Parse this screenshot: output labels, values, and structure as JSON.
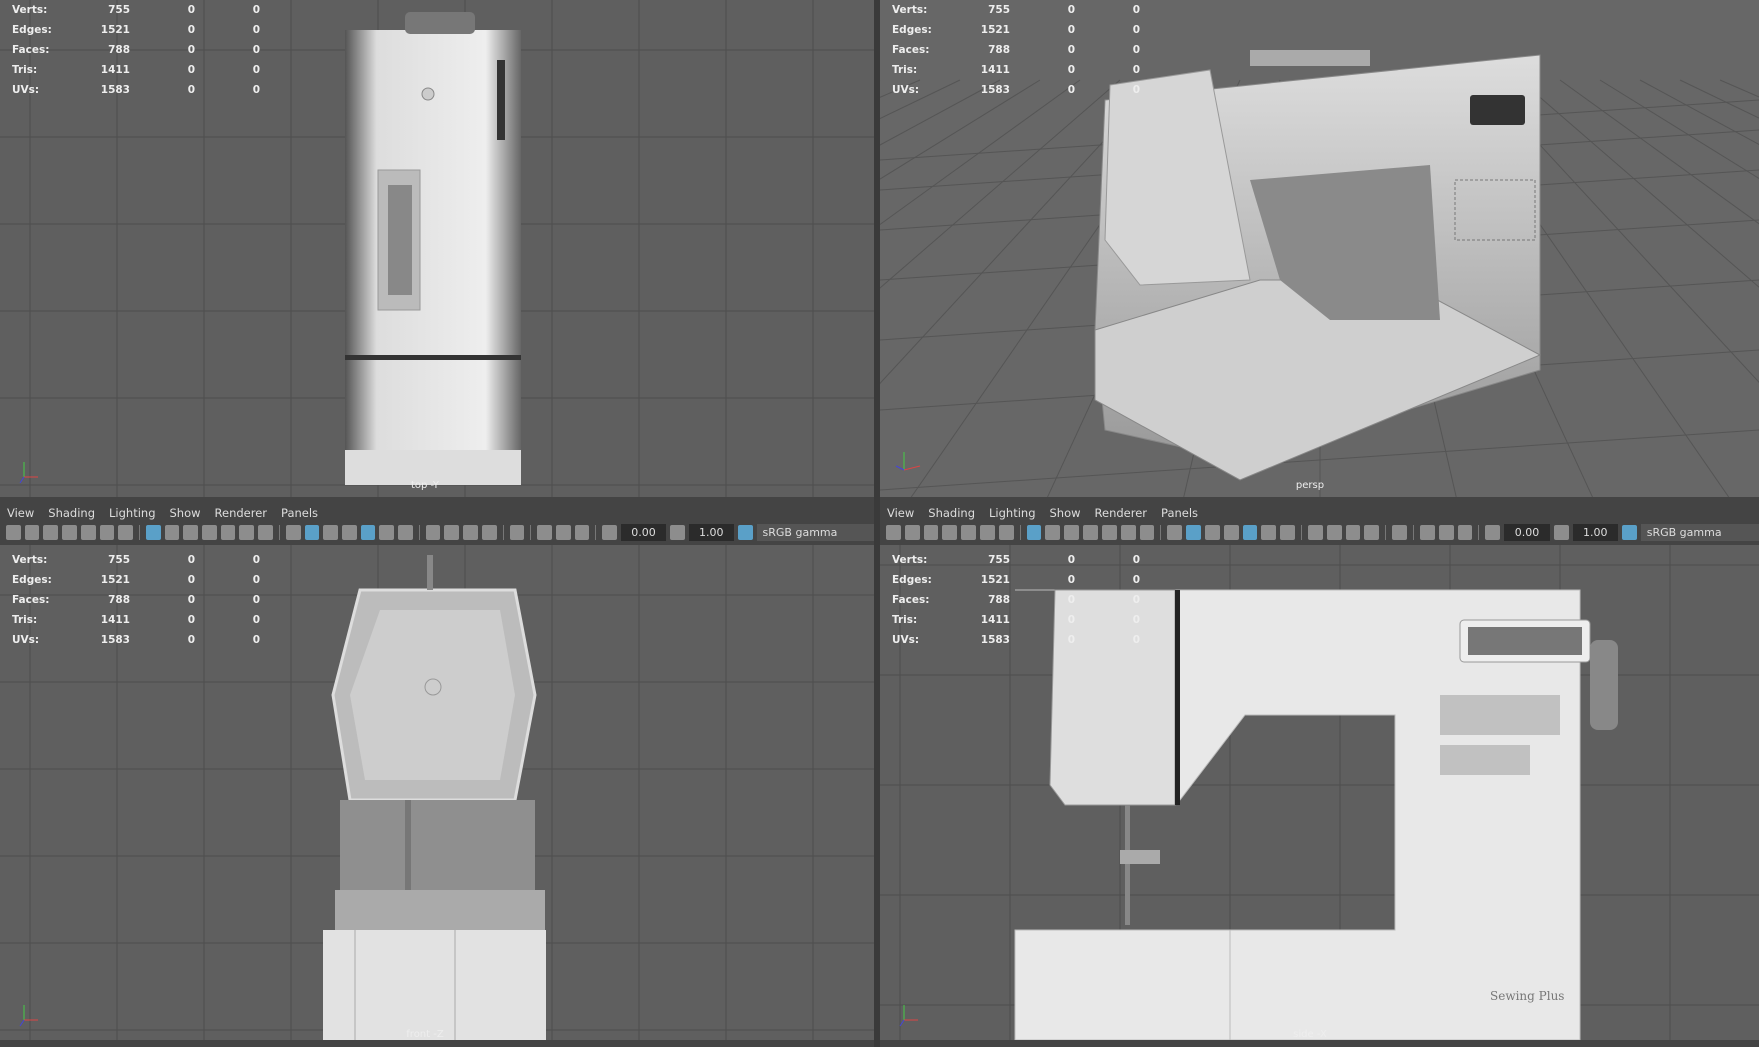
{
  "hud": [
    {
      "label": "Verts:",
      "value": "755",
      "a": "0",
      "b": "0"
    },
    {
      "label": "Edges:",
      "value": "1521",
      "a": "0",
      "b": "0"
    },
    {
      "label": "Faces:",
      "value": "788",
      "a": "0",
      "b": "0"
    },
    {
      "label": "Tris:",
      "value": "1411",
      "a": "0",
      "b": "0"
    },
    {
      "label": "UVs:",
      "value": "1583",
      "a": "0",
      "b": "0"
    }
  ],
  "viewports": {
    "top": "top -Y",
    "persp": "persp",
    "front": "front -Z",
    "side": "side -X"
  },
  "menu": [
    "View",
    "Shading",
    "Lighting",
    "Show",
    "Renderer",
    "Panels"
  ],
  "toolbar": {
    "exposure": "0.00",
    "gamma": "1.00",
    "color_space": "sRGB gamma",
    "icons": [
      "camera-icon",
      "camera-attributes-icon",
      "bookmark-camera-icon",
      "bookmark-icon",
      "image-plane-icon",
      "pan-zoom-icon",
      "grease-pencil-icon",
      "|",
      "grid-icon",
      "film-gate-icon",
      "resolution-gate-icon",
      "gate-mask-icon",
      "field-chart-icon",
      "safe-action-icon",
      "safe-title-icon",
      "|",
      "wireframe-icon",
      "smooth-shade-icon",
      "default-material-icon",
      "wireframe-on-shaded-icon",
      "textured-icon",
      "lights-icon",
      "shadows-icon",
      "|",
      "screen-space-ao-icon",
      "motion-blur-icon",
      "anti-aliasing-icon",
      "depth-of-field-icon",
      "|",
      "isolate-select-icon",
      "|",
      "xray-icon",
      "xray-joints-icon",
      "backface-culling-icon",
      "|",
      "exposure-icon",
      "#exposure",
      "gamma-icon",
      "#gamma",
      "color-management-icon",
      "#colorspace"
    ],
    "active": [
      "grid-icon",
      "smooth-shade-icon",
      "textured-icon",
      "color-management-icon"
    ]
  },
  "colors": {
    "viewport_bg": "#5f5f5f",
    "grid": "#4e4e4e",
    "panel": "#444444",
    "accent": "#5aa0c8"
  },
  "branding": "Sewing Plus"
}
